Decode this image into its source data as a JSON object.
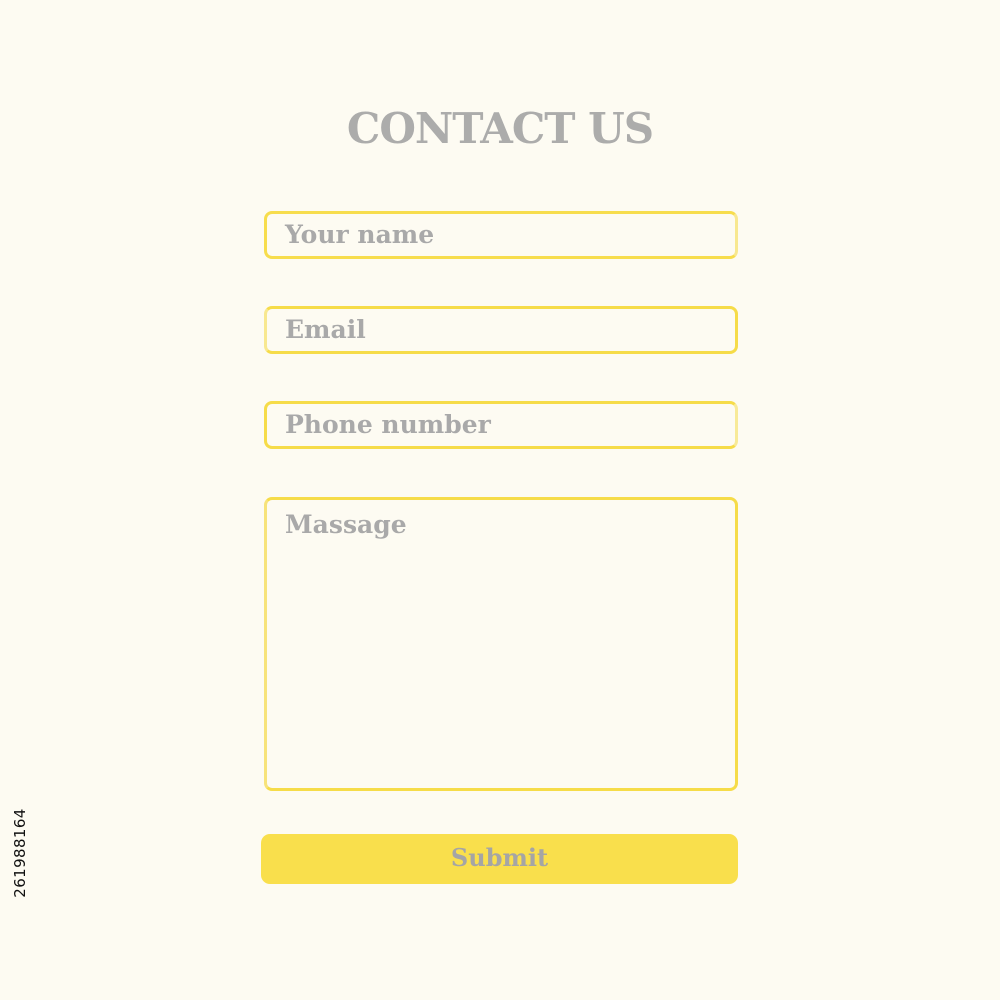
{
  "header": {
    "title": "CONTACT US"
  },
  "form": {
    "fields": [
      {
        "label": "Your name"
      },
      {
        "label": "Email"
      },
      {
        "label": "Phone number"
      },
      {
        "label": "Massage"
      }
    ],
    "submit_label": "Submit"
  },
  "watermark": {
    "id": "261988164"
  },
  "colors": {
    "background": "#fdfbf2",
    "accent_yellow": "#f9df4c",
    "text_gray": "#a8a8a8"
  }
}
